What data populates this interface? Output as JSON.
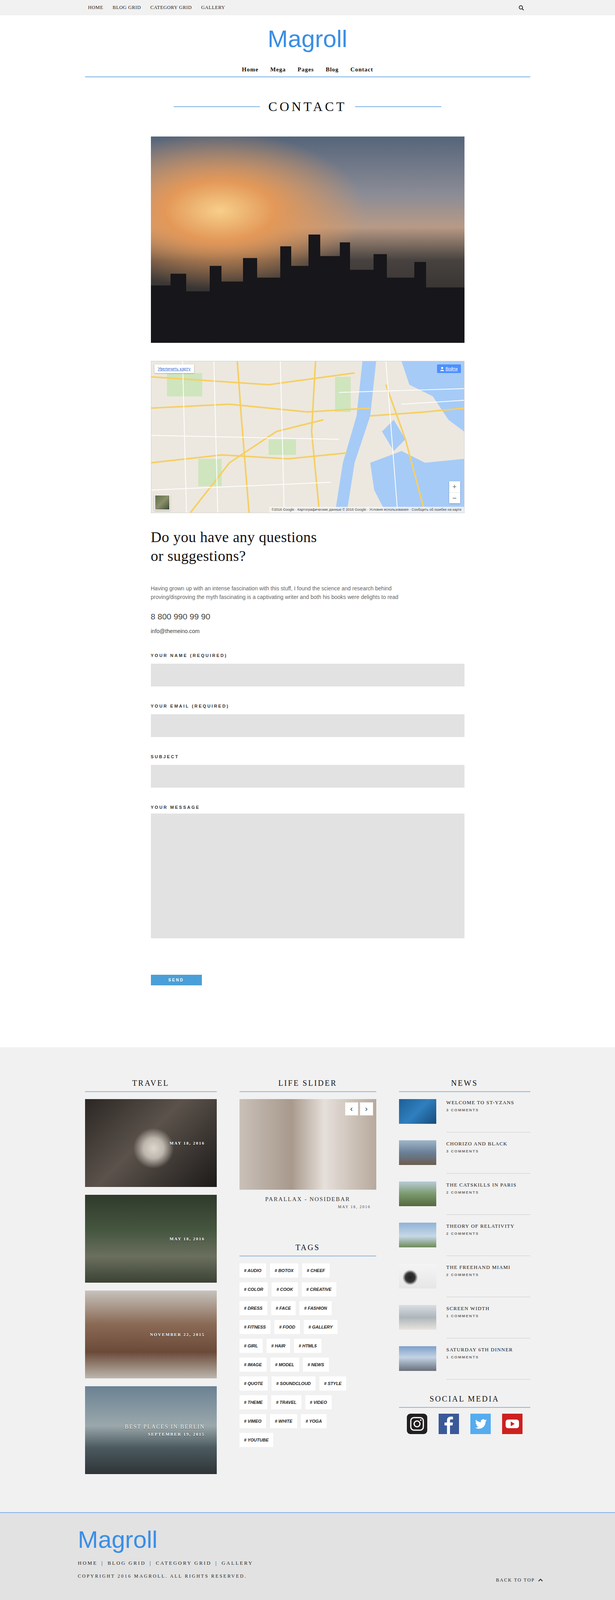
{
  "top_menu": [
    "HOME",
    "BLOG GRID",
    "CATEGORY GRID",
    "GALLERY"
  ],
  "brand": "Magroll",
  "main_menu": [
    "Home",
    "Mega",
    "Pages",
    "Blog",
    "Contact"
  ],
  "page_title": "CONTACT",
  "map": {
    "enlarge": "Увеличить карту",
    "sign_in": "Войти",
    "zoom_in": "+",
    "zoom_out": "−",
    "attribution": "©2016 Google · Картографические данные © 2016 Google · Условия использования · Сообщить об ошибке на карте"
  },
  "contact": {
    "heading": [
      "Do you have any questions",
      "or suggestions?"
    ],
    "text": [
      "Having grown up with an intense fascination with this stuff, I found the science and research behind",
      "proving/disproving the myth fascinating is a captivating writer and both his books were delights to read"
    ],
    "phone": "8 800 990 99 90",
    "email": "info@themeino.com"
  },
  "form": {
    "fields": [
      {
        "label": "YOUR NAME (REQUIRED)",
        "kind": "input"
      },
      {
        "label": "YOUR EMAIL (REQUIRED)",
        "kind": "input"
      },
      {
        "label": "SUBJECT",
        "kind": "input"
      },
      {
        "label": "YOUR MESSAGE",
        "kind": "textarea"
      }
    ],
    "submit": "SEND"
  },
  "travel": {
    "title": "TRAVEL",
    "posts": [
      {
        "date": "MAY 18, 2016"
      },
      {
        "date": "MAY 18, 2016"
      },
      {
        "date": "NOVEMBER 22, 2015"
      },
      {
        "title": "BEST PLACES IN BERLIN",
        "date": "SEPTEMBER 19, 2015"
      }
    ]
  },
  "life_slider": {
    "title": "LIFE SLIDER",
    "prev": "‹",
    "next": "›",
    "post": {
      "title": "PARALLAX - NOSIDEBAR",
      "date": "MAY 18, 2016"
    }
  },
  "tags": {
    "title": "TAGS",
    "items": [
      "# AUDIO",
      "# BOTOX",
      "# CHEEF",
      "# COLOR",
      "# COOK",
      "# CREATIVE",
      "# DRESS",
      "# FACE",
      "# FASHION",
      "# FITNESS",
      "# FOOD",
      "# GALLERY",
      "# GIRL",
      "# HAIR",
      "# HTML5",
      "# IMAGE",
      "# MODEL",
      "# NEWS",
      "# QUOTE",
      "# SOUNDCLOUD",
      "# STYLE",
      "# THEME",
      "# TRAVEL",
      "# VIDEO",
      "# VIMEO",
      "# WHITE",
      "# YOGA",
      "# YOUTUBE"
    ]
  },
  "news": {
    "title": "NEWS",
    "items": [
      {
        "title": "WELCOME TO ST-YZANS",
        "comments": "3 COMMENTS"
      },
      {
        "title": "CHORIZO AND BLACK",
        "comments": "3 COMMENTS"
      },
      {
        "title": "THE CATSKILLS IN PARIS",
        "comments": "2 COMMENTS"
      },
      {
        "title": "THEORY OF RELATIVITY",
        "comments": "2 COMMENTS"
      },
      {
        "title": "THE FREEHAND MIAMI",
        "comments": "2 COMMENTS"
      },
      {
        "title": "SCREEN WIDTH",
        "comments": "1 COMMENTS"
      },
      {
        "title": "SATURDAY 6TH DINNER",
        "comments": "1 COMMENTS"
      }
    ]
  },
  "social": {
    "title": "SOCIAL MEDIA",
    "items": [
      {
        "kind": "instagram",
        "color": "#231f20"
      },
      {
        "kind": "facebook",
        "color": "#3b5998"
      },
      {
        "kind": "twitter",
        "color": "#55acee"
      },
      {
        "kind": "youtube",
        "color": "#cd201f"
      }
    ]
  },
  "footer": {
    "brand": "Magroll",
    "links": [
      "HOME",
      "BLOG GRID",
      "CATEGORY GRID",
      "GALLERY"
    ],
    "separator": "|",
    "copyright": "COPYRIGHT 2016 MAGROLL. ALL RIGHTS RESERVED.",
    "back_to_top": "BACK TO TOP"
  }
}
